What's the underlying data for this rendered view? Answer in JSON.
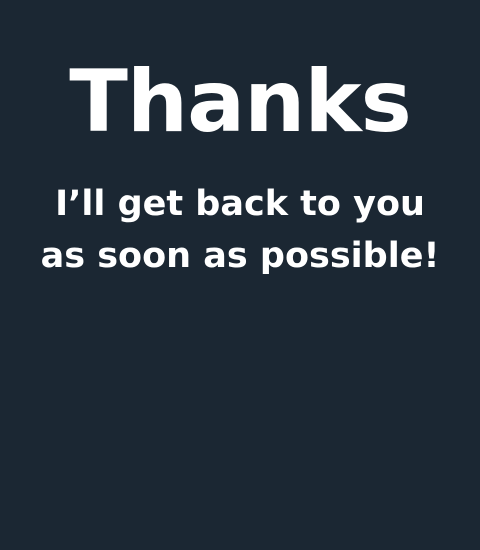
{
  "thanks": {
    "title": "Thanks",
    "message_line_1": "I’ll get back to you",
    "message_line_2": "as soon as possible!"
  },
  "colors": {
    "background": "#1b2733",
    "text": "#ffffff"
  }
}
